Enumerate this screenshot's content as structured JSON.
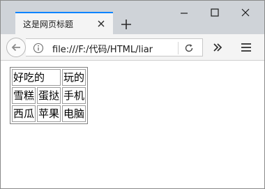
{
  "window": {
    "tab_title": "这是网页标题",
    "url": "file:///F:/代码/HTML/liar"
  },
  "table": {
    "rows": [
      [
        {
          "text": "好吃的",
          "colspan": 2
        },
        {
          "text": "玩的",
          "colspan": 1
        }
      ],
      [
        {
          "text": "雪糕",
          "colspan": 1
        },
        {
          "text": "蛋挞",
          "colspan": 1
        },
        {
          "text": "手机",
          "colspan": 1
        }
      ],
      [
        {
          "text": "西瓜",
          "colspan": 1
        },
        {
          "text": "苹果",
          "colspan": 1
        },
        {
          "text": "电脑",
          "colspan": 1
        }
      ]
    ]
  },
  "colors": {
    "tab_accent": "#0a84ff",
    "titlebar_bg": "#cfd3d8",
    "toolbar_bg": "#f4f4f4"
  },
  "icons": {
    "tab_close": "close-icon",
    "new_tab": "plus-icon",
    "minimize": "minimize-icon",
    "maximize": "maximize-icon",
    "close": "close-icon",
    "back": "back-arrow-icon",
    "info": "info-icon",
    "reload": "reload-icon",
    "overflow": "double-chevron-icon",
    "menu": "hamburger-menu-icon"
  }
}
